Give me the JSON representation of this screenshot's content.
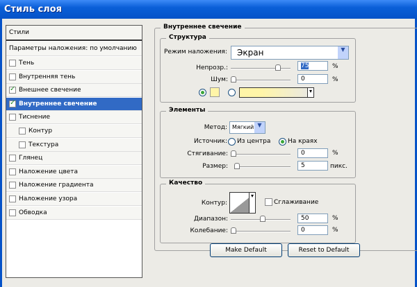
{
  "title": "Стиль слоя",
  "left": {
    "styles_header": "Стили",
    "blend_options": "Параметры наложения: по умолчанию",
    "items": [
      {
        "label": "Тень",
        "checked": false
      },
      {
        "label": "Внутренняя тень",
        "checked": false
      },
      {
        "label": "Внешнее свечение",
        "checked": true
      },
      {
        "label": "Внутреннее свечение",
        "checked": true,
        "selected": true
      },
      {
        "label": "Тиснение",
        "checked": false
      },
      {
        "label": "Контур",
        "checked": false
      },
      {
        "label": "Текстура",
        "checked": false
      },
      {
        "label": "Глянец",
        "checked": false
      },
      {
        "label": "Наложение цвета",
        "checked": false
      },
      {
        "label": "Наложение градиента",
        "checked": false
      },
      {
        "label": "Наложение узора",
        "checked": false
      },
      {
        "label": "Обводка",
        "checked": false
      }
    ]
  },
  "panel": {
    "title": "Внутреннее свечение",
    "structure": {
      "title": "Структура",
      "blend_label": "Режим наложения:",
      "blend_value": "Экран",
      "opacity_label": "Непрозр.:",
      "opacity": "75",
      "noise_label": "Шум:",
      "noise": "0",
      "pct": "%",
      "color": "#fff5a8"
    },
    "elements": {
      "title": "Элементы",
      "method_label": "Метод:",
      "method_value": "Мягкий",
      "source_label": "Источник:",
      "source_center": "Из центра",
      "source_edge": "На краях",
      "choke_label": "Стягивание:",
      "choke": "0",
      "size_label": "Размер:",
      "size": "5",
      "px": "пикс."
    },
    "quality": {
      "title": "Качество",
      "contour_label": "Контур:",
      "antialias_label": "Сглаживание",
      "range_label": "Диапазон:",
      "range": "50",
      "jitter_label": "Колебание:",
      "jitter": "0"
    },
    "make_default": "Make Default",
    "reset_default": "Reset to Default"
  }
}
